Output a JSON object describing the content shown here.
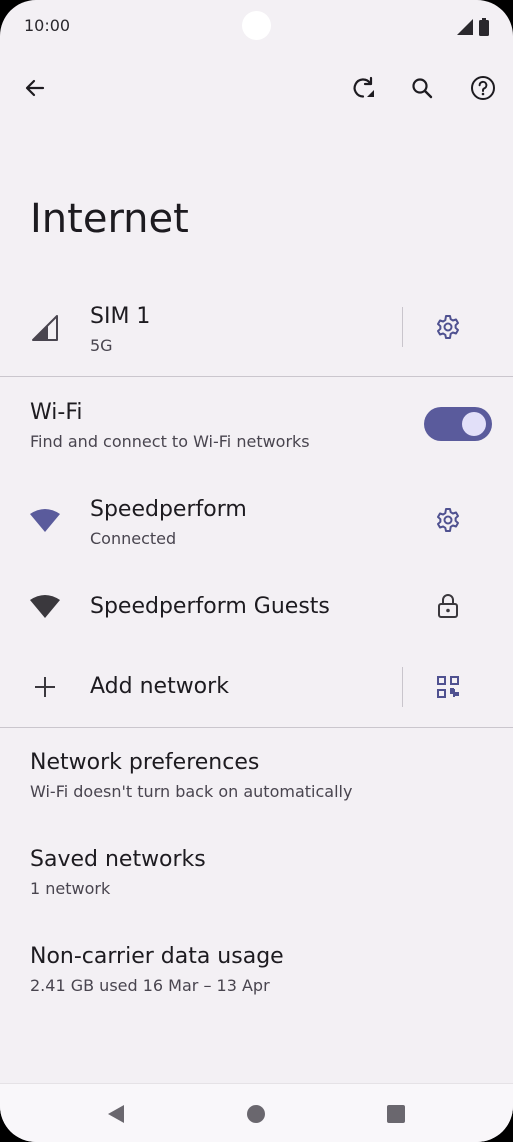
{
  "status": {
    "time": "10:00"
  },
  "toolbar": {
    "back_icon": "arrow-left-icon",
    "reset_icon": "network-reset-icon",
    "search_icon": "search-icon",
    "help_icon": "help-icon"
  },
  "page": {
    "title": "Internet"
  },
  "sim": {
    "title": "SIM 1",
    "subtitle": "5G"
  },
  "wifi": {
    "title": "Wi-Fi",
    "subtitle": "Find and connect to Wi-Fi networks",
    "enabled": true
  },
  "networks": [
    {
      "name": "Speedperform",
      "status": "Connected"
    },
    {
      "name": "Speedperform Guests",
      "status": ""
    }
  ],
  "add_network": {
    "label": "Add network"
  },
  "settings": [
    {
      "title": "Network preferences",
      "subtitle": "Wi-Fi doesn't turn back on automatically"
    },
    {
      "title": "Saved networks",
      "subtitle": "1 network"
    },
    {
      "title": "Non-carrier data usage",
      "subtitle": "2.41 GB used 16 Mar – 13 Apr"
    }
  ],
  "colors": {
    "accent": "#5a5b9c",
    "background": "#f3f0f4"
  }
}
